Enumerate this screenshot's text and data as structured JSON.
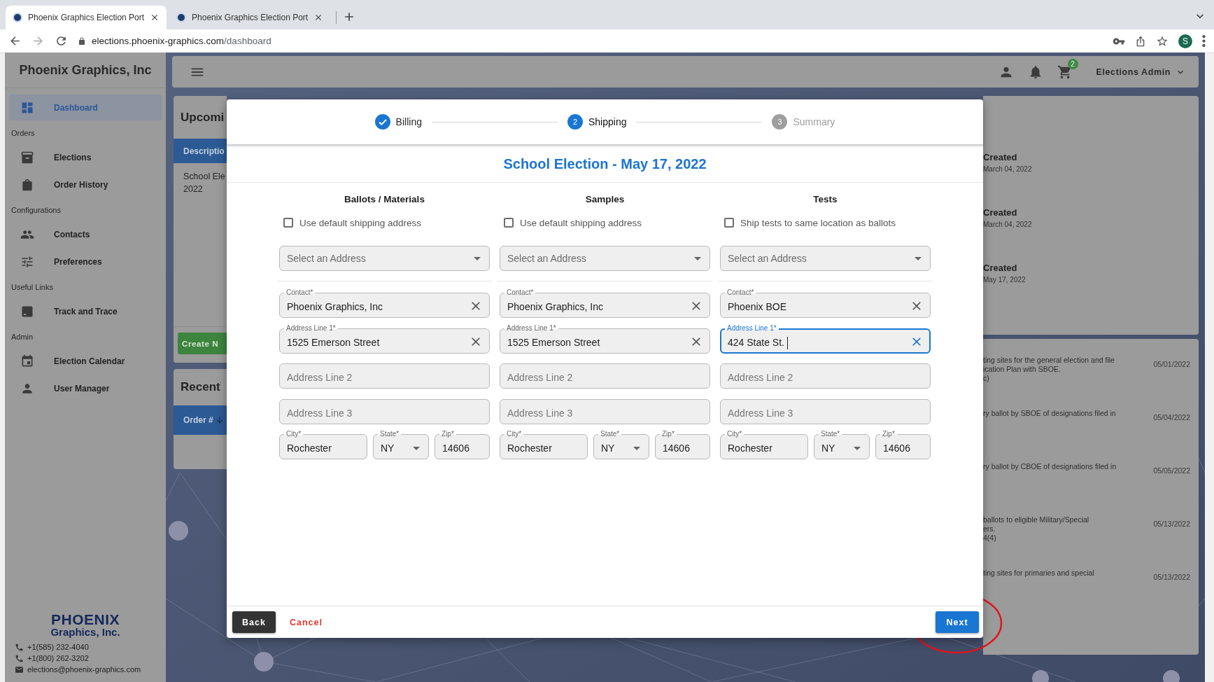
{
  "browser": {
    "tabs": [
      {
        "title": "Phoenix Graphics Election Port",
        "selected": true
      },
      {
        "title": "Phoenix Graphics Election Port",
        "selected": false
      }
    ],
    "url_host": "elections.phoenix-graphics.com",
    "url_path": "/dashboard",
    "profile_initial": "S"
  },
  "sidebar": {
    "brand": "Phoenix Graphics, Inc",
    "items": [
      {
        "kind": "link",
        "label": "Dashboard",
        "selected": true
      },
      {
        "kind": "heading",
        "label": "Orders"
      },
      {
        "kind": "link",
        "label": "Elections",
        "selected": false
      },
      {
        "kind": "link",
        "label": "Order History",
        "selected": false
      },
      {
        "kind": "heading",
        "label": "Configurations"
      },
      {
        "kind": "link",
        "label": "Contacts",
        "selected": false
      },
      {
        "kind": "link",
        "label": "Preferences",
        "selected": false
      },
      {
        "kind": "heading",
        "label": "Useful Links"
      },
      {
        "kind": "link",
        "label": "Track and Trace",
        "selected": false
      },
      {
        "kind": "heading",
        "label": "Admin"
      },
      {
        "kind": "link",
        "label": "Election Calendar",
        "selected": false
      },
      {
        "kind": "link",
        "label": "User Manager",
        "selected": false
      }
    ],
    "logo": {
      "line_1": "PHOENIX",
      "line_2": "Graphics, Inc."
    },
    "contacts": [
      {
        "kind": "phone",
        "text": "+1(585) 232-4040"
      },
      {
        "kind": "phone",
        "text": "+1(800) 262-3202"
      },
      {
        "kind": "email",
        "text": "elections@phoenix-graphics.com"
      }
    ]
  },
  "header": {
    "cart_badge": "2",
    "user_name": "Elections Admin"
  },
  "upcoming_card": {
    "title": "Upcomi",
    "column": "Descriptio",
    "cell_lines": [
      "School Ele",
      "2022"
    ],
    "button": "Create N"
  },
  "recent_card": {
    "title": "Recent",
    "column": "Order #"
  },
  "status_card": {
    "items": [
      {
        "status": "Created",
        "date": "March 04, 2022"
      },
      {
        "status": "Created",
        "date": "March 04, 2022"
      },
      {
        "status": "Created",
        "date": "May 17, 2022"
      }
    ]
  },
  "deadlines_card": {
    "rows": [
      {
        "lines": [
          "ting sites for the general election and file",
          "ication Plan with SBOE.",
          "c)"
        ],
        "date": "05/01/2022"
      },
      {
        "lines": [
          "ry ballot by SBOE of designations filed in"
        ],
        "date": "05/04/2022"
      },
      {
        "lines": [
          "ry ballot by CBOE of designations filed in"
        ],
        "date": "05/05/2022"
      },
      {
        "lines": [
          "ballots to eligible Military/Special",
          "ers.",
          "4(4)"
        ],
        "date": "05/13/2022"
      },
      {
        "lines": [
          "ting sites for primaries and special"
        ],
        "date": "05/13/2022"
      }
    ]
  },
  "modal": {
    "steps": [
      {
        "label": "Billing",
        "completed": true,
        "selected": false
      },
      {
        "label": "Shipping",
        "number": "2",
        "completed": false,
        "selected": true
      },
      {
        "label": "Summary",
        "number": "3",
        "completed": false,
        "selected": false
      }
    ],
    "title": "School Election - May 17, 2022",
    "columns": [
      {
        "heading": "Ballots / Materials",
        "checkbox": {
          "label": "Use default shipping address",
          "checked": false
        },
        "select": {
          "placeholder": "Select an Address"
        },
        "contact": {
          "label": "Contact*",
          "value": "Phoenix Graphics, Inc",
          "focused": false
        },
        "address_1": {
          "label": "Address Line 1*",
          "value": "1525 Emerson Street",
          "focused": false
        },
        "address_2": {
          "placeholder": "Address Line 2"
        },
        "address_3": {
          "placeholder": "Address Line 3"
        },
        "city": {
          "label": "City*",
          "value": "Rochester"
        },
        "state": {
          "label": "State*",
          "value": "NY"
        },
        "zip": {
          "label": "Zip*",
          "value": "14606"
        }
      },
      {
        "heading": "Samples",
        "checkbox": {
          "label": "Use default shipping address",
          "checked": false
        },
        "select": {
          "placeholder": "Select an Address"
        },
        "contact": {
          "label": "Contact*",
          "value": "Phoenix Graphics, Inc",
          "focused": false
        },
        "address_1": {
          "label": "Address Line 1*",
          "value": "1525 Emerson Street",
          "focused": false
        },
        "address_2": {
          "placeholder": "Address Line 2"
        },
        "address_3": {
          "placeholder": "Address Line 3"
        },
        "city": {
          "label": "City*",
          "value": "Rochester"
        },
        "state": {
          "label": "State*",
          "value": "NY"
        },
        "zip": {
          "label": "Zip*",
          "value": "14606"
        }
      },
      {
        "heading": "Tests",
        "checkbox": {
          "label": "Ship tests to same location as ballots",
          "checked": false
        },
        "select": {
          "placeholder": "Select an Address"
        },
        "contact": {
          "label": "Contact*",
          "value": "Phoenix BOE",
          "focused": false
        },
        "address_1": {
          "label": "Address Line 1*",
          "value": "424 State St.",
          "focused": true
        },
        "address_2": {
          "placeholder": "Address Line 2"
        },
        "address_3": {
          "placeholder": "Address Line 3"
        },
        "city": {
          "label": "City*",
          "value": "Rochester"
        },
        "state": {
          "label": "State*",
          "value": "NY"
        },
        "zip": {
          "label": "Zip*",
          "value": "14606"
        }
      }
    ],
    "buttons": {
      "back": "Back",
      "cancel": "Cancel",
      "next": "Next"
    }
  }
}
